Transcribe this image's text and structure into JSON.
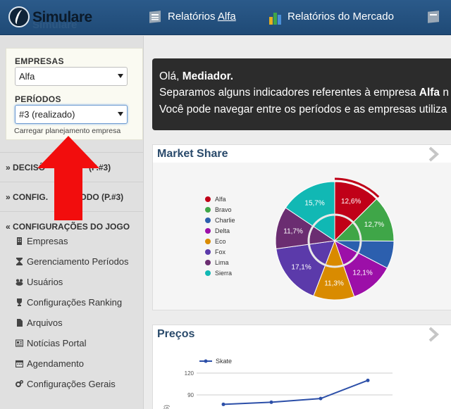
{
  "topbar": {
    "brand": "Simulare",
    "nav": [
      {
        "label": "Relatórios ",
        "highlight": "Alfa",
        "icon": "newspaper-icon"
      },
      {
        "label": "Relatórios do Mercado",
        "icon": "bar-chart-icon"
      },
      {
        "label": "",
        "icon": "newspaper-icon"
      }
    ]
  },
  "filters": {
    "empresas_label": "EMPRESAS",
    "empresas_value": "Alfa",
    "periodos_label": "PERÍODOS",
    "periodos_value": "#3 (realizado)",
    "load_plan": "Carregar planejamento empresa"
  },
  "sidebar": {
    "sections": [
      {
        "label": "DECISÕ",
        "suffix": "(P.#3)",
        "icon": "chevron-down-icon"
      },
      {
        "label": "CONFIG. ",
        "suffix": "PERÍODO (P.#3)",
        "icon": "chevron-down-icon"
      },
      {
        "label": "CONFIGURAÇÕES DO JOGO",
        "icon": "chevron-up-icon"
      }
    ],
    "items": [
      {
        "label": "Empresas",
        "icon": "building-icon"
      },
      {
        "label": "Gerenciamento Períodos",
        "icon": "hourglass-icon"
      },
      {
        "label": "Usuários",
        "icon": "users-icon"
      },
      {
        "label": "Configurações Ranking",
        "icon": "trophy-icon"
      },
      {
        "label": "Arquivos",
        "icon": "file-icon"
      },
      {
        "label": "Notícias Portal",
        "icon": "newspaper-icon"
      },
      {
        "label": "Agendamento",
        "icon": "calendar-icon"
      },
      {
        "label": "Configurações Gerais",
        "icon": "cogs-icon"
      }
    ]
  },
  "welcome": {
    "greeting": "Olá, ",
    "user": "Mediador.",
    "line2_prefix": "Separamos alguns indicadores referentes à empresa ",
    "line2_company": "Alfa",
    "line2_suffix": " n",
    "line3": "Você pode navegar entre os períodos e as empresas utiliza"
  },
  "market_share": {
    "title": "Market Share",
    "chart_data": {
      "type": "pie",
      "labels": [
        "Alfa",
        "Bravo",
        "Charlie",
        "Delta",
        "Eco",
        "Fox",
        "Lima",
        "Sierra"
      ],
      "values": [
        12.6,
        12.7,
        7.6,
        12.1,
        11.3,
        17.1,
        11.7,
        15.7
      ],
      "data_labels": [
        "12,6%",
        "12,7%",
        "",
        "12,1%",
        "11,3%",
        "17,1%",
        "11,7%",
        "15,7%"
      ],
      "colors": [
        "#c00018",
        "#3fa648",
        "#2c5fae",
        "#9c0fa8",
        "#d98b00",
        "#5b3aaa",
        "#6b2d71",
        "#11b8b4"
      ],
      "legend": "left"
    }
  },
  "precos": {
    "title": "Preços",
    "chart_data": {
      "type": "line",
      "series": [
        {
          "name": "Skate",
          "values": [
            77,
            80,
            85,
            110
          ]
        }
      ],
      "yticks": [
        "120",
        "90"
      ],
      "ylabel": "(S)",
      "color": "#2c4fa8"
    }
  }
}
